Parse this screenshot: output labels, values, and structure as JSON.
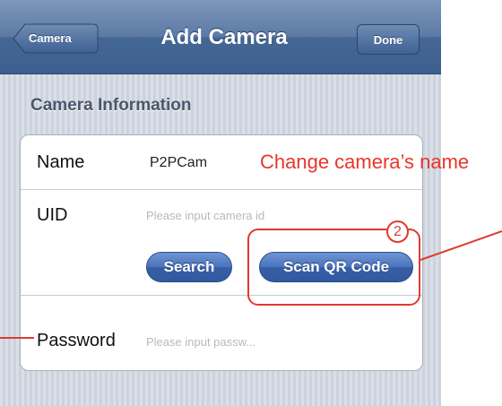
{
  "navbar": {
    "back_label": "Camera",
    "title": "Add Camera",
    "done_label": "Done"
  },
  "section": {
    "header": "Camera Information"
  },
  "form": {
    "name": {
      "label": "Name",
      "value": "P2PCam"
    },
    "uid": {
      "label": "UID",
      "placeholder": "Please input camera id"
    },
    "search_label": "Search",
    "scan_label": "Scan QR Code",
    "password": {
      "label": "Password",
      "placeholder": "Please input passw..."
    }
  },
  "annotations": {
    "name_note": "Change camera’s name",
    "step_number": "2"
  },
  "colors": {
    "navbar": "#3c5f8f",
    "button": "#3a62aa",
    "annotation": "#e8352b"
  }
}
